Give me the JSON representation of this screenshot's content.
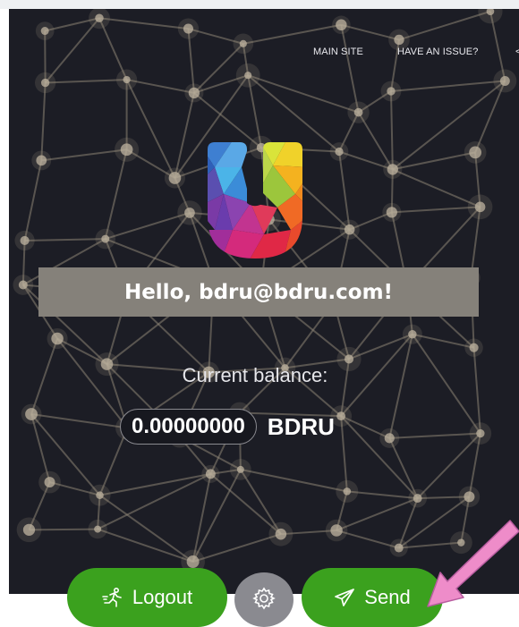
{
  "nav": {
    "main_site": "MAIN SITE",
    "have_issue": "HAVE AN ISSUE?",
    "more": "<"
  },
  "greeting": "Hello, bdru@bdru.com!",
  "balance": {
    "label": "Current balance:",
    "amount": "0.00000000",
    "currency": "BDRU"
  },
  "actions": {
    "logout_label": "Logout",
    "send_label": "Send"
  },
  "icons": {
    "logout": "running-person-icon",
    "settings": "gear-icon",
    "send": "paper-plane-icon"
  },
  "colors": {
    "background": "#1c1d25",
    "greeting_bar": "#85817a",
    "button_green": "#3ba11e",
    "settings_gray": "#8a8a90",
    "annotation_arrow": "#ee8cc9"
  }
}
